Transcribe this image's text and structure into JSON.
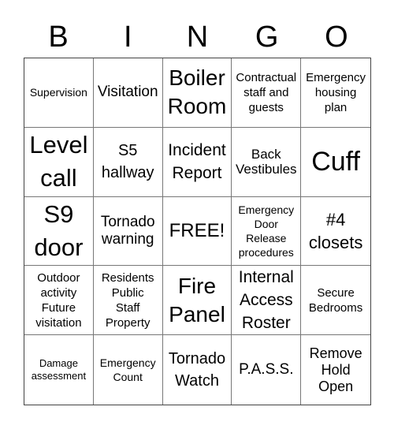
{
  "header": {
    "letters": [
      "B",
      "I",
      "N",
      "G",
      "O"
    ]
  },
  "cells": [
    "Supervision",
    "Visitation",
    "Boiler\nRoom",
    "Contractual\nstaff and\nguests",
    "Emergency\nhousing\nplan",
    "Level\ncall",
    "S5\nhallway",
    "Incident\nReport",
    "Back\nVestibules",
    "Cuff",
    "S9\ndoor",
    "Tornado\nwarning",
    "FREE!",
    "Emergency\nDoor\nRelease\nprocedures",
    "#4\nclosets",
    "Outdoor\nactivity\nFuture\nvisitation",
    "Residents\nPublic\nStaff\nProperty",
    "Fire\nPanel",
    "Internal\nAccess\nRoster",
    "Secure\nBedrooms",
    "Damage\nassessment",
    "Emergency\nCount",
    "Tornado\nWatch",
    "P.A.S.S.",
    "Remove\nHold\nOpen"
  ]
}
